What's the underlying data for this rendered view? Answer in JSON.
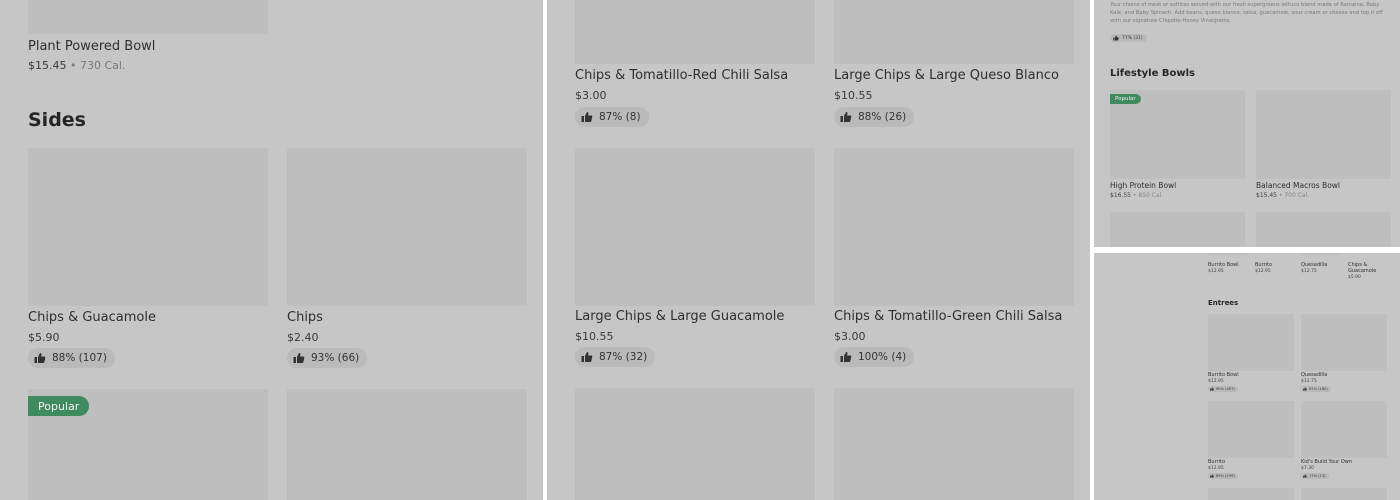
{
  "panel1": {
    "top_item": {
      "name": "Plant Powered Bowl",
      "price": "$15.45",
      "separator": " • ",
      "calories": "730 Cal."
    },
    "section_title": "Sides",
    "items": [
      {
        "name": "Chips & Guacamole",
        "price": "$5.90",
        "rating": "88% (107)"
      },
      {
        "name": "Chips",
        "price": "$2.40",
        "rating": "93% (66)"
      }
    ],
    "badge": "Popular"
  },
  "panel2": {
    "items": [
      {
        "name": "Chips & Tomatillo-Red Chili Salsa",
        "price": "$3.00",
        "rating": "87% (8)"
      },
      {
        "name": "Large Chips & Large Queso Blanco",
        "price": "$10.55",
        "rating": "88% (26)"
      },
      {
        "name": "Large Chips & Large Guacamole",
        "price": "$10.55",
        "rating": "87% (32)"
      },
      {
        "name": "Chips & Tomatillo-Green Chili Salsa",
        "price": "$3.00",
        "rating": "100% (4)"
      }
    ]
  },
  "panel3": {
    "description": "Your choice of meat or sofritas served with our fresh supergreens lettuce blend made of Romaine, Baby Kale, and Baby Spinach. Add beans, queso blanco, salsa, guacamole, sour cream or cheese and top it off with our signature Chipotle-Honey Vinaigrette.",
    "rating": "77% (31)",
    "section_title": "Lifestyle Bowls",
    "badge": "Popular",
    "items": [
      {
        "name": "High Protein Bowl",
        "price": "$16.55",
        "separator": " • ",
        "calories": "850 Cal."
      },
      {
        "name": "Balanced Macros Bowl",
        "price": "$15.45",
        "separator": " • ",
        "calories": "700 Cal."
      }
    ]
  },
  "panel4": {
    "top_row": [
      {
        "name": "Burrito Bowl",
        "price": "$12.95"
      },
      {
        "name": "Burrito",
        "price": "$12.95"
      },
      {
        "name": "Quesadilla",
        "price": "$12.75"
      },
      {
        "name": "Chips & Guacamole",
        "price": "$5.90"
      }
    ],
    "section_title": "Entrees",
    "items": [
      {
        "name": "Burrito Bowl",
        "price": "$12.95",
        "rating": "90% (407)"
      },
      {
        "name": "Quesadilla",
        "price": "$12.75",
        "rating": "92% (180)"
      },
      {
        "name": "Burrito",
        "price": "$12.95",
        "rating": "89% (199)"
      },
      {
        "name": "Kid's Build Your Own",
        "price": "$7.30",
        "rating": "77% (13)"
      }
    ]
  },
  "colors": {
    "overlay": "#c6c6c6",
    "image_placeholder": "#bebebe",
    "badge_green": "#3f8a5e",
    "divider": "#ffffff"
  },
  "icons": {
    "rating": "thumbs-up-icon"
  }
}
